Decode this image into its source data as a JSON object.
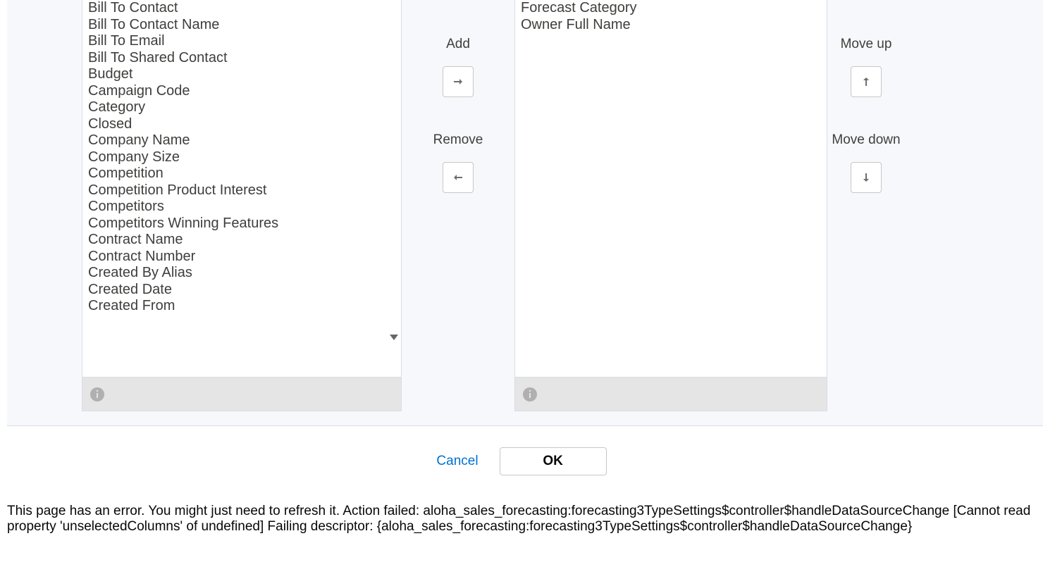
{
  "available": {
    "items": [
      "Bill To Contact",
      "Bill To Contact Name",
      "Bill To Email",
      "Bill To Shared Contact",
      "Budget",
      "Campaign Code",
      "Category",
      "Closed",
      "Company Name",
      "Company Size",
      "Competition",
      "Competition Product Interest",
      "Competitors",
      "Competitors Winning Features",
      "Contract Name",
      "Contract Number",
      "Created By Alias",
      "Created Date",
      "Created From"
    ]
  },
  "selected": {
    "items": [
      "Forecast Category",
      "Owner Full Name"
    ]
  },
  "controls": {
    "add_label": "Add",
    "remove_label": "Remove",
    "move_up_label": "Move up",
    "move_down_label": "Move down"
  },
  "footer": {
    "cancel_label": "Cancel",
    "ok_label": "OK"
  },
  "error_text": "This page has an error. You might just need to refresh it. Action failed: aloha_sales_forecasting:forecasting3TypeSettings$controller$handleDataSourceChange [Cannot read property 'unselectedColumns' of undefined] Failing descriptor: {aloha_sales_forecasting:forecasting3TypeSettings$controller$handleDataSourceChange}"
}
